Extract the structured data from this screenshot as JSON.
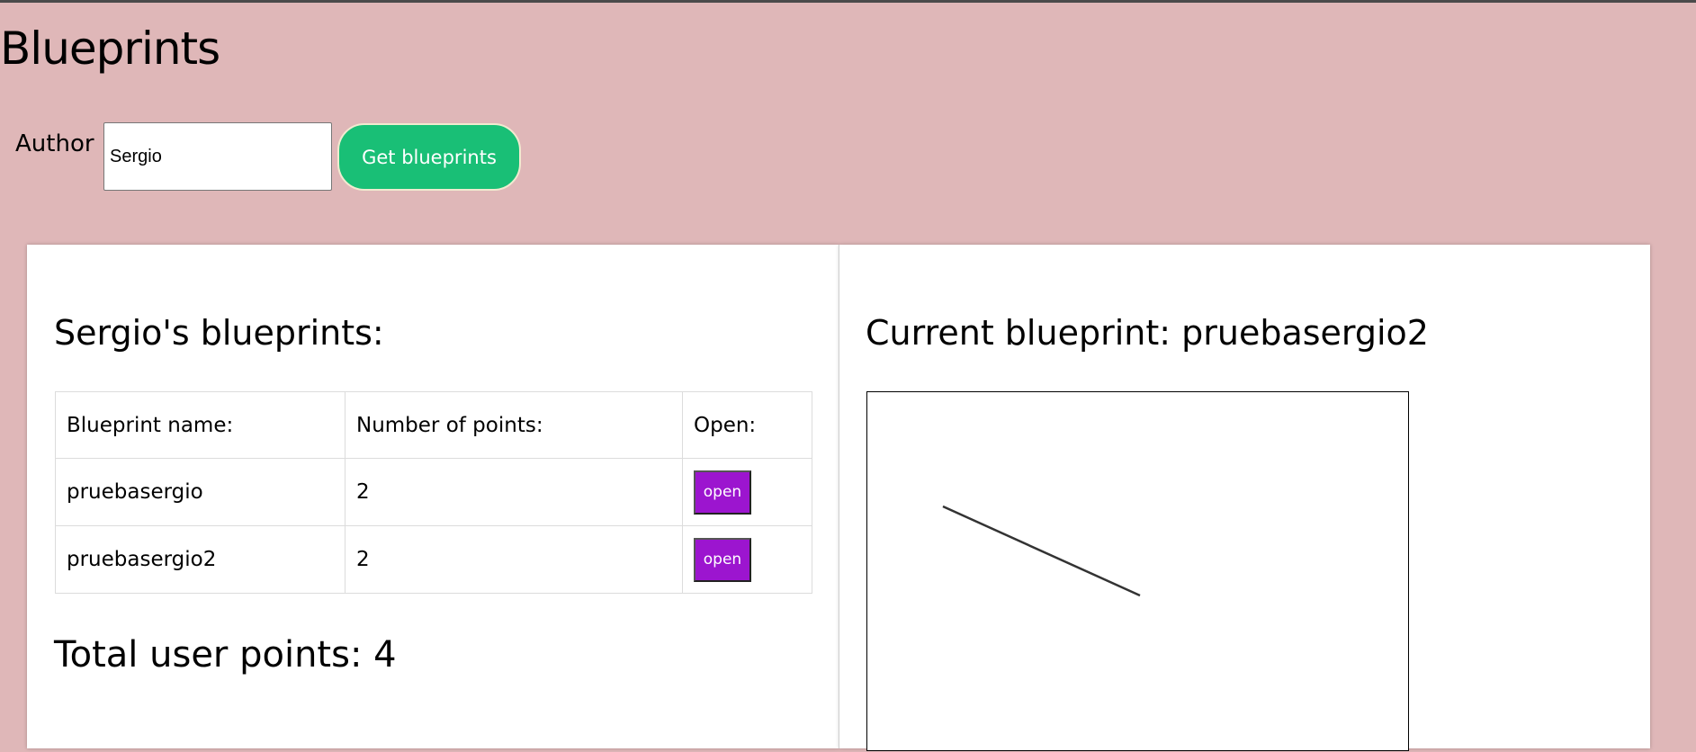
{
  "header": {
    "title": "Blueprints"
  },
  "search": {
    "author_label": "Author",
    "author_value": "Sergio",
    "button_label": "Get blueprints"
  },
  "blueprint_list": {
    "heading": "Sergio's blueprints:",
    "columns": [
      "Blueprint name:",
      "Number of points:",
      "Open:"
    ],
    "rows": [
      {
        "name": "pruebasergio",
        "points": "2",
        "action_label": "open"
      },
      {
        "name": "pruebasergio2",
        "points": "2",
        "action_label": "open"
      }
    ],
    "total_label": "Total user points: 4"
  },
  "current_blueprint": {
    "heading": "Current blueprint: pruebasergio2"
  },
  "colors": {
    "background": "#dfb7b8",
    "get_button": "#19bf76",
    "open_button": "#9c15cf"
  }
}
